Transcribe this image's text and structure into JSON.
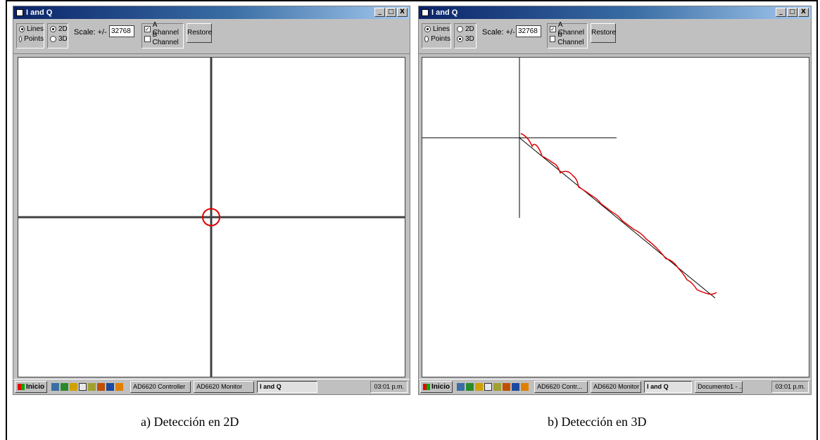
{
  "captions": {
    "left": "a) Detección en 2D",
    "right": "b) Detección en 3D"
  },
  "window_a": {
    "title": "I and Q",
    "controls": {
      "minimize": "_",
      "maximize": "□",
      "close": "X"
    },
    "mode": {
      "lines": "Lines",
      "points": "Points",
      "selected": "Lines"
    },
    "dim": {
      "two_d": "2D",
      "three_d": "3D",
      "selected": "2D"
    },
    "scale_label": "Scale: +/-",
    "scale_value": "32768",
    "a_channel": "A Channel",
    "b_channel": "B Channel",
    "a_checked": true,
    "b_checked": false,
    "restore": "Restore",
    "taskbar": {
      "start": "Inicio",
      "tasks": [
        "AD6620 Controller",
        "AD6620 Monitor",
        "I and Q"
      ],
      "active_task": "I and Q",
      "clock": "03:01 p.m."
    }
  },
  "window_b": {
    "title": "I and Q",
    "controls": {
      "minimize": "_",
      "maximize": "□",
      "close": "X"
    },
    "mode": {
      "lines": "Lines",
      "points": "Points",
      "selected": "Lines"
    },
    "dim": {
      "two_d": "2D",
      "three_d": "3D",
      "selected": "3D"
    },
    "scale_label": "Scale: +/-",
    "scale_value": "32768",
    "a_channel": "A Channel",
    "b_channel": "B Channel",
    "a_checked": true,
    "b_checked": false,
    "restore": "Restore",
    "taskbar": {
      "start": "Inicio",
      "tasks": [
        "AD6620 Contr...",
        "AD6620 Monitor",
        "I and Q",
        "Documento1 - ..."
      ],
      "active_task": "I and Q",
      "clock": "03:01 p.m."
    }
  },
  "colors": {
    "title_gradient_start": "#0a246a",
    "face": "#c0c0c0",
    "trace": "#e00000",
    "axis": "#404040"
  }
}
